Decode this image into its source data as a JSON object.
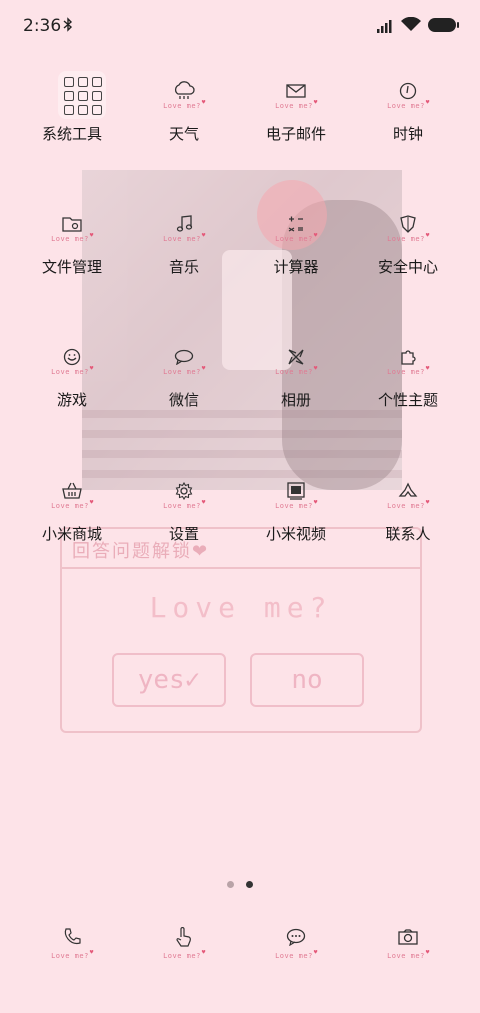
{
  "status_bar": {
    "time": "2:36"
  },
  "apps": [
    {
      "label": "系统工具",
      "icon": "folder-icon",
      "sub": ""
    },
    {
      "label": "天气",
      "icon": "weather-icon",
      "sub": "Love me?"
    },
    {
      "label": "电子邮件",
      "icon": "mail-icon",
      "sub": "Love me?"
    },
    {
      "label": "时钟",
      "icon": "clock-icon",
      "sub": "Love me?"
    },
    {
      "label": "文件管理",
      "icon": "file-manager-icon",
      "sub": "Love me?"
    },
    {
      "label": "音乐",
      "icon": "music-icon",
      "sub": "Love me?"
    },
    {
      "label": "计算器",
      "icon": "calculator-icon",
      "sub": "Love me?"
    },
    {
      "label": "安全中心",
      "icon": "shield-icon",
      "sub": "Love me?"
    },
    {
      "label": "游戏",
      "icon": "game-icon",
      "sub": "Love me?"
    },
    {
      "label": "微信",
      "icon": "wechat-icon",
      "sub": "Love me?"
    },
    {
      "label": "相册",
      "icon": "gallery-icon",
      "sub": "Love me?"
    },
    {
      "label": "个性主题",
      "icon": "theme-icon",
      "sub": "Love me?"
    },
    {
      "label": "小米商城",
      "icon": "shop-basket-icon",
      "sub": "Love me?"
    },
    {
      "label": "设置",
      "icon": "gear-icon",
      "sub": "Love me?"
    },
    {
      "label": "小米视频",
      "icon": "video-icon",
      "sub": "Love me?"
    },
    {
      "label": "联系人",
      "icon": "contacts-icon",
      "sub": "Love me?"
    }
  ],
  "wallpaper": {
    "question": "回答问题解锁❤",
    "love": "Love me?",
    "yes": "yes✓",
    "no": "no"
  },
  "pages": {
    "count": 2,
    "active": 2
  },
  "dock": [
    {
      "icon": "phone-icon",
      "sub": "Love me?"
    },
    {
      "icon": "hand-pointer-icon",
      "sub": "Love me?"
    },
    {
      "icon": "message-icon",
      "sub": "Love me?"
    },
    {
      "icon": "camera-icon",
      "sub": "Love me?"
    }
  ],
  "colors": {
    "background": "#fde3e8",
    "accent": "#e07a93"
  }
}
